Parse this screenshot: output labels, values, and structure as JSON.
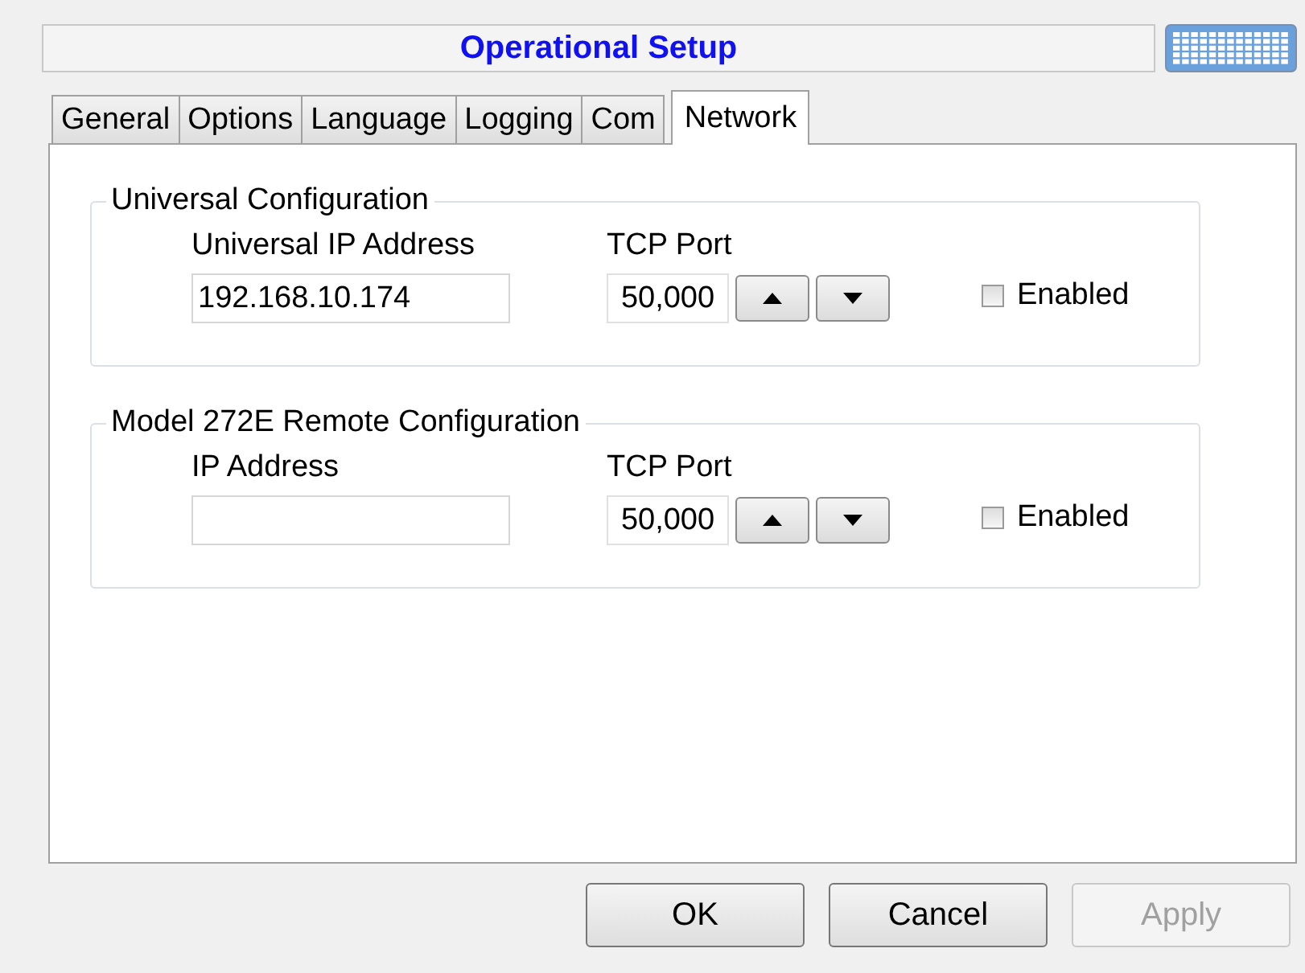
{
  "window": {
    "title": "Operational Setup"
  },
  "tabs": [
    {
      "label": "General",
      "selected": false
    },
    {
      "label": "Options",
      "selected": false
    },
    {
      "label": "Language",
      "selected": false
    },
    {
      "label": "Logging",
      "selected": false
    },
    {
      "label": "Com",
      "selected": false
    },
    {
      "label": "Network",
      "selected": true
    }
  ],
  "groups": [
    {
      "title": "Universal Configuration",
      "address_label": "Universal IP Address",
      "address_value": "192.168.10.174",
      "port_label": "TCP Port",
      "port_value": "50,000",
      "enabled_label": "Enabled",
      "enabled": false
    },
    {
      "title": "Model 272E Remote Configuration",
      "address_label": "IP Address",
      "port_label": "TCP Port",
      "port_value": "50,000",
      "enabled_label": "Enabled",
      "enabled": false
    }
  ],
  "buttons": [
    {
      "label": "OK",
      "disabled": false
    },
    {
      "label": "Cancel",
      "disabled": false
    },
    {
      "label": "Apply",
      "disabled": true
    }
  ]
}
